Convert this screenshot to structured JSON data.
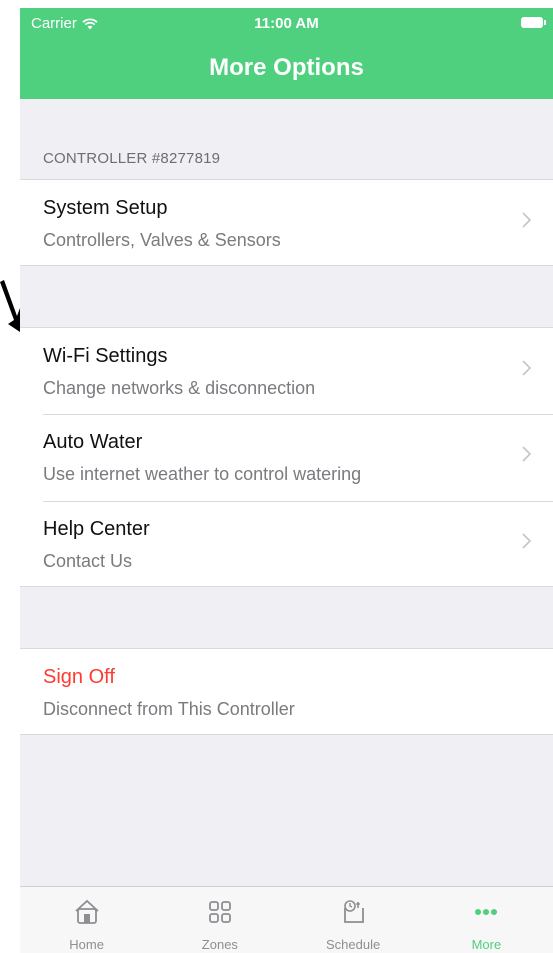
{
  "status_bar": {
    "carrier": "Carrier",
    "time": "11:00 AM"
  },
  "nav": {
    "title": "More Options"
  },
  "section": {
    "header": "CONTROLLER #8277819"
  },
  "groups": {
    "setup": [
      {
        "title": "System Setup",
        "subtitle": "Controllers, Valves & Sensors"
      }
    ],
    "settings": [
      {
        "title": "Wi-Fi Settings",
        "subtitle": "Change networks & disconnection"
      },
      {
        "title": "Auto Water",
        "subtitle": "Use internet weather to control watering"
      },
      {
        "title": "Help Center",
        "subtitle": "Contact Us"
      }
    ],
    "account": [
      {
        "title": "Sign Off",
        "subtitle": "Disconnect from This Controller"
      }
    ]
  },
  "tabs": [
    {
      "label": "Home",
      "icon": "home-icon"
    },
    {
      "label": "Zones",
      "icon": "zones-icon"
    },
    {
      "label": "Schedule",
      "icon": "schedule-icon"
    },
    {
      "label": "More",
      "icon": "more-icon",
      "active": true
    }
  ],
  "colors": {
    "brand_green": "#4fd07f",
    "danger_red": "#ff3b30",
    "background": "#efeff4"
  }
}
